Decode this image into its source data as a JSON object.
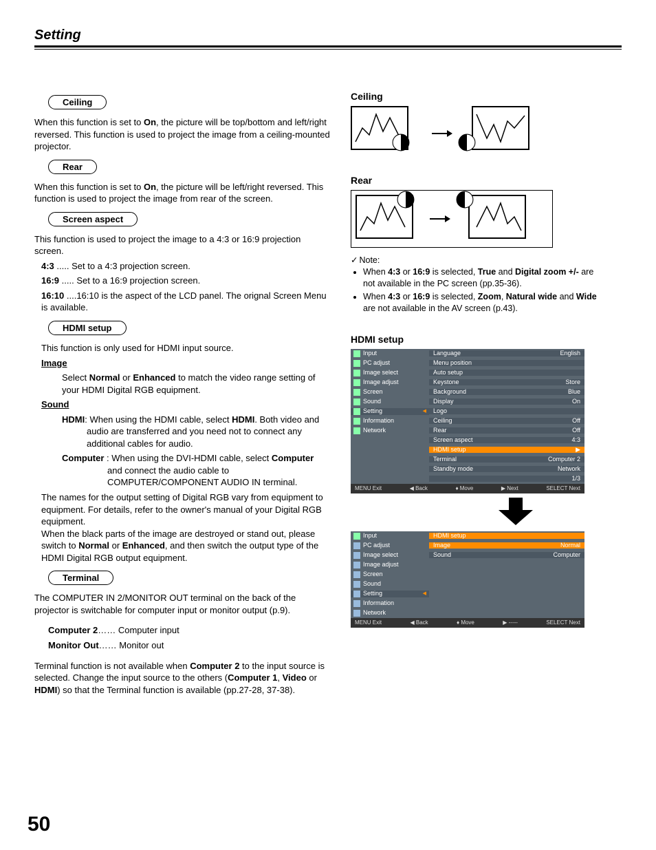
{
  "pageTitle": "Setting",
  "pageNumber": "50",
  "sections": {
    "ceiling": {
      "label": "Ceiling",
      "text_pre": "When this function is set to ",
      "bold": "On",
      "text_post": ", the picture will be top/bottom and left/right reversed. This function is used to project the image from a ceiling-mounted projector."
    },
    "rear": {
      "label": "Rear",
      "text_pre": "When this function is set to ",
      "bold": "On",
      "text_post": ", the picture will be left/right reversed. This function is used to project the image from rear of the screen."
    },
    "aspect": {
      "label": "Screen aspect",
      "intro": "This function is used to project the image to a 4:3 or 16:9 projection screen.",
      "items": [
        {
          "k": "4:3",
          "dots": " .....   ",
          "v": "Set to a 4:3 projection screen."
        },
        {
          "k": "16:9",
          "dots": " ..... ",
          "v": "Set to a 16:9 projection screen."
        },
        {
          "k": "16:10",
          "dots": " ....",
          "v": "16:10 is the aspect of the LCD panel. The orignal Screen Menu is available."
        }
      ]
    },
    "hdmi": {
      "label": "HDMI setup",
      "intro": "This function is only used for HDMI input source.",
      "image_label": " Image",
      "image_text": [
        "Select ",
        "Normal",
        " or ",
        "Enhanced",
        " to match the video range setting of your HDMI Digital RGB equipment."
      ],
      "sound_label": " Sound",
      "hdmi_opt": [
        "HDMI",
        ": When using the HDMI cable, select ",
        "HDMI",
        ". Both video and audio are transferred and you need not to connect any additional cables for audio."
      ],
      "comp_opt": [
        "Computer",
        " : When using the DVI-HDMI cable, select ",
        "Computer",
        " and connect the audio cable to COMPUTER/COMPONENT AUDIO IN terminal."
      ],
      "para2": [
        "The names for the output setting of Digital RGB vary from equipment to equipment. For details, refer to the owner's manual of your Digital RGB equipment.",
        "When the black parts of the image are destroyed or stand out, please switch to "
      ],
      "para2_bold1": "Normal",
      "para2_mid": " or ",
      "para2_bold2": "Enhanced",
      "para2_end": ", and then switch the output type of the HDMI Digital RGB output equipment."
    },
    "terminal": {
      "label": "Terminal",
      "intro": "The COMPUTER IN 2/MONITOR OUT terminal on the back of the projector is switchable for computer input or monitor output (p.9).",
      "opts": [
        {
          "k": "Computer 2",
          "dots": "…… ",
          "v": "Computer input"
        },
        {
          "k": "Monitor Out",
          "dots": "…… ",
          "v": "Monitor out"
        }
      ],
      "note": [
        "Terminal function is not available when ",
        "Computer 2",
        " to the input source is selected. Change the input source to the others (",
        "Computer 1",
        ", ",
        "Video",
        " or ",
        "HDMI",
        ") so that the Terminal function is  available (pp.27-28, 37-38)."
      ]
    }
  },
  "right": {
    "ceiling_h": "Ceiling",
    "rear_h": "Rear",
    "note_label": "Note:",
    "notes": [
      [
        "When ",
        "4:3",
        " or ",
        "16:9",
        " is selected, ",
        "True",
        " and ",
        "Digital zoom +/-",
        " are not available in the PC screen (pp.35-36)."
      ],
      [
        "When ",
        "4:3",
        " or ",
        "16:9",
        " is selected, ",
        "Zoom",
        ", ",
        "Natural wide",
        " and ",
        "Wide",
        " are not available in the  AV screen (p.43)."
      ]
    ],
    "hdmi_h": "HDMI setup",
    "menuLeft": [
      "Input",
      "PC adjust",
      "Image select",
      "Image adjust",
      "Screen",
      "Sound",
      "Setting",
      "Information",
      "Network"
    ],
    "menu1Right": [
      {
        "l": "Language",
        "r": "English"
      },
      {
        "l": "Menu position",
        "r": ""
      },
      {
        "l": "Auto setup",
        "r": ""
      },
      {
        "l": "Keystone",
        "r": "Store"
      },
      {
        "l": "Background",
        "r": "Blue"
      },
      {
        "l": "Display",
        "r": "On"
      },
      {
        "l": "Logo",
        "r": ""
      },
      {
        "l": "Ceiling",
        "r": "Off"
      },
      {
        "l": "Rear",
        "r": "Off"
      },
      {
        "l": "Screen aspect",
        "r": "4:3"
      },
      {
        "l": "HDMI setup",
        "r": ""
      },
      {
        "l": "Terminal",
        "r": "Computer 2"
      },
      {
        "l": "Standby mode",
        "r": "Network"
      },
      {
        "l": "",
        "r": "1/3"
      }
    ],
    "menu1Footer": {
      "exit": "MENU Exit",
      "back": "◀ Back",
      "move": "♦ Move",
      "next1": "▶ Next",
      "next2": "SELECT Next"
    },
    "menu2RightHeader": "HDMI setup",
    "menu2Right": [
      {
        "l": "Image",
        "r": "Normal"
      },
      {
        "l": "Sound",
        "r": "Computer"
      }
    ],
    "menu2Footer": {
      "exit": "MENU Exit",
      "back": "◀ Back",
      "move": "♦ Move",
      "next1": "▶ -----",
      "next2": "SELECT Next"
    }
  }
}
